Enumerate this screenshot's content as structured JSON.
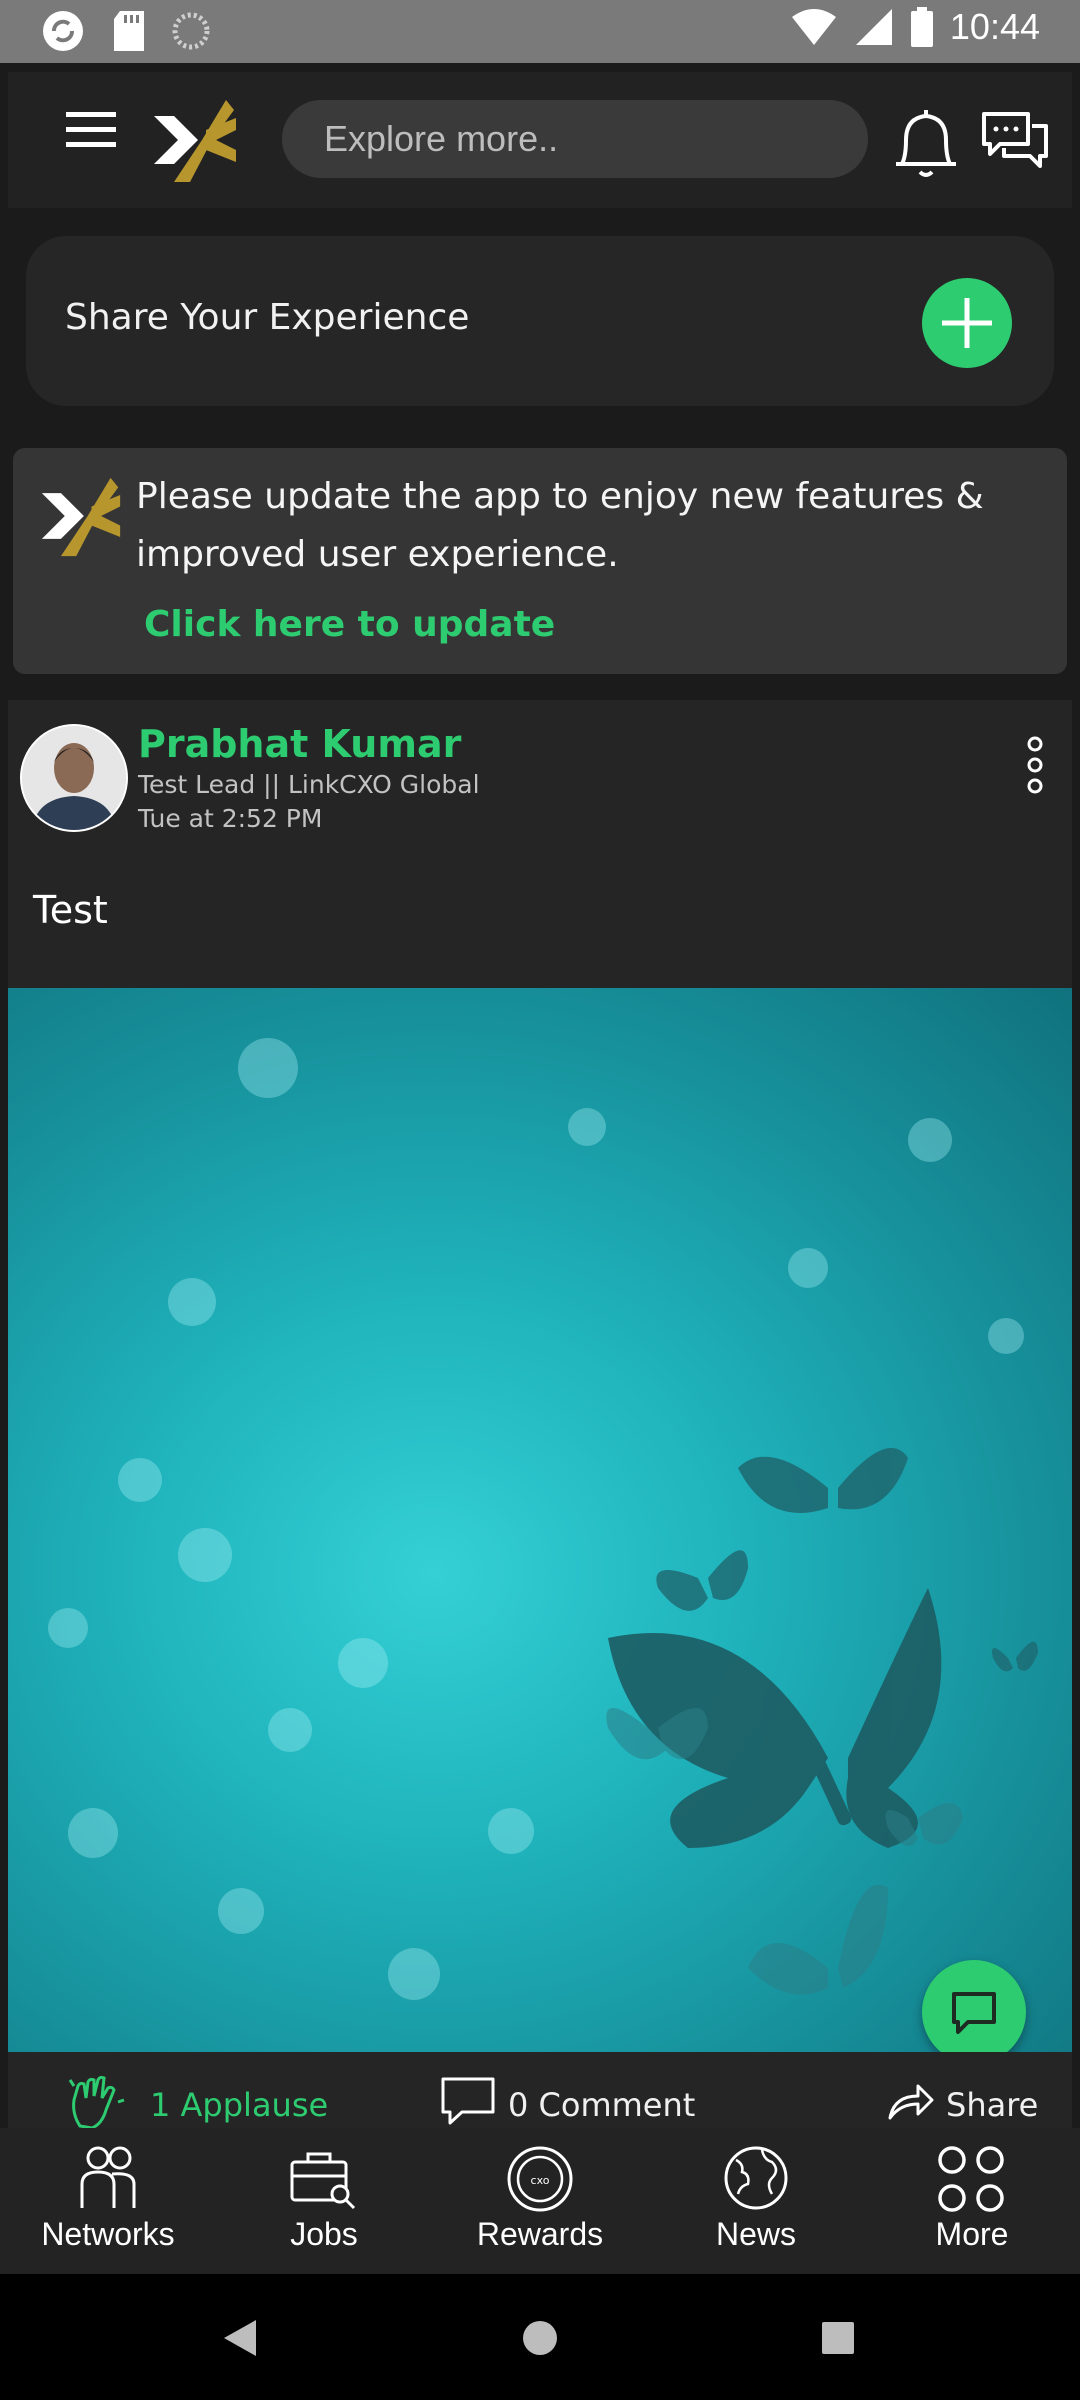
{
  "status_bar": {
    "time": "10:44",
    "icons": [
      "sync-icon",
      "sd-card-icon",
      "loading-icon",
      "wifi-icon",
      "signal-icon",
      "battery-icon"
    ]
  },
  "header": {
    "menu_icon": "hamburger-menu-icon",
    "logo": "linkcxo-logo",
    "search_placeholder": "Explore more..",
    "notification_icon": "bell-icon",
    "chat_icon": "chat-bubbles-icon"
  },
  "share_card": {
    "label": "Share Your Experience",
    "add_icon": "plus-icon"
  },
  "update_banner": {
    "line1": "Please update the app to enjoy new features &",
    "line2": "improved user experience.",
    "link_label": "Click here to update"
  },
  "post": {
    "author_name": "Prabhat Kumar",
    "author_title": "Test Lead ||  LinkCXO Global",
    "timestamp": "Tue at 2:52 PM",
    "text": "Test",
    "image": "teal bokeh background with butterflies",
    "applause_label": "1 Applause",
    "comment_label": "0 Comment",
    "share_label": "Share"
  },
  "bottom_nav": {
    "items": [
      {
        "label": "Networks",
        "icon": "people-icon"
      },
      {
        "label": "Jobs",
        "icon": "briefcase-search-icon"
      },
      {
        "label": "Rewards",
        "icon": "cxo-coin-icon"
      },
      {
        "label": "News",
        "icon": "globe-icon"
      },
      {
        "label": "More",
        "icon": "four-circles-icon"
      }
    ]
  },
  "colors": {
    "accent": "#2ecc71",
    "background": "#1b1b1b",
    "card": "#262626",
    "logo_gold": "#b8962e"
  }
}
